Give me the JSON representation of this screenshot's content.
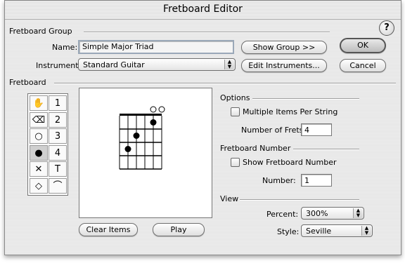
{
  "window": {
    "title": "Fretboard Editor"
  },
  "group": {
    "section": "Fretboard Group",
    "name_label": "Name:",
    "name_value": "Simple Major Triad",
    "instrument_label": "Instrument:",
    "instrument_value": "Standard Guitar",
    "show_group": "Show Group >>",
    "edit_instruments": "Edit Instruments...",
    "ok": "OK",
    "cancel": "Cancel",
    "help": "?"
  },
  "fretboard": {
    "section": "Fretboard",
    "tools": [
      {
        "glyph": "✋",
        "icon": "hand-icon"
      },
      {
        "glyph": "1",
        "icon": "finger-1-icon"
      },
      {
        "glyph": "⌫",
        "icon": "eraser-icon"
      },
      {
        "glyph": "2",
        "icon": "finger-2-icon"
      },
      {
        "glyph": "○",
        "icon": "open-circle-icon"
      },
      {
        "glyph": "3",
        "icon": "finger-3-icon"
      },
      {
        "glyph": "●",
        "icon": "filled-circle-icon"
      },
      {
        "glyph": "4",
        "icon": "finger-4-icon"
      },
      {
        "glyph": "✕",
        "icon": "x-mark-icon"
      },
      {
        "glyph": "T",
        "icon": "thumb-icon"
      },
      {
        "glyph": "◇",
        "icon": "diamond-icon"
      },
      {
        "glyph": "⌒",
        "icon": "barre-arc-icon"
      }
    ],
    "selected_tool": 6,
    "clear_items": "Clear Items",
    "play": "Play",
    "diagram": {
      "strings": 6,
      "frets": 4,
      "open_strings": [
        5,
        6
      ],
      "dots": [
        {
          "string": 5,
          "fret": 1
        },
        {
          "string": 3,
          "fret": 2
        },
        {
          "string": 2,
          "fret": 3
        }
      ]
    }
  },
  "options": {
    "section": "Options",
    "multiple_items": "Multiple Items Per String",
    "num_frets_label": "Number of Frets:",
    "num_frets_value": "4"
  },
  "fretnum": {
    "section": "Fretboard Number",
    "show_label": "Show Fretboard Number",
    "number_label": "Number:",
    "number_value": "1"
  },
  "view": {
    "section": "View",
    "percent_label": "Percent:",
    "percent_value": "300%",
    "style_label": "Style:",
    "style_value": "Seville"
  }
}
